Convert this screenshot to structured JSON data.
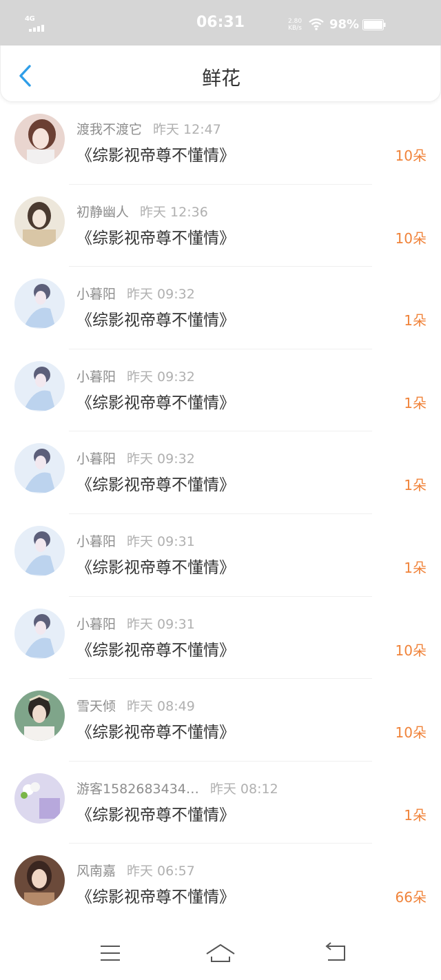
{
  "status_bar": {
    "network": "4G",
    "time": "06:31",
    "speed_value": "2.80",
    "speed_unit": "KB/s",
    "battery": "98%"
  },
  "header": {
    "title": "鲜花",
    "back_icon": "chevron-left-icon"
  },
  "colors": {
    "accent_blue": "#2f9ee8",
    "quantity_orange": "#f0833a"
  },
  "gifts": [
    {
      "user": "渡我不渡它",
      "time": "昨天 12:47",
      "book": "《综影视帝尊不懂情》",
      "quantity": "10朵"
    },
    {
      "user": "初静幽人",
      "time": "昨天 12:36",
      "book": "《综影视帝尊不懂情》",
      "quantity": "10朵"
    },
    {
      "user": "小暮阳",
      "time": "昨天 09:32",
      "book": "《综影视帝尊不懂情》",
      "quantity": "1朵"
    },
    {
      "user": "小暮阳",
      "time": "昨天 09:32",
      "book": "《综影视帝尊不懂情》",
      "quantity": "1朵"
    },
    {
      "user": "小暮阳",
      "time": "昨天 09:32",
      "book": "《综影视帝尊不懂情》",
      "quantity": "1朵"
    },
    {
      "user": "小暮阳",
      "time": "昨天 09:31",
      "book": "《综影视帝尊不懂情》",
      "quantity": "1朵"
    },
    {
      "user": "小暮阳",
      "time": "昨天 09:31",
      "book": "《综影视帝尊不懂情》",
      "quantity": "10朵"
    },
    {
      "user": "雪天倾",
      "time": "昨天 08:49",
      "book": "《综影视帝尊不懂情》",
      "quantity": "10朵"
    },
    {
      "user": "游客1582683434…",
      "time": "昨天 08:12",
      "book": "《综影视帝尊不懂情》",
      "quantity": "1朵"
    },
    {
      "user": "风南嘉",
      "time": "昨天 06:57",
      "book": "《综影视帝尊不懂情》",
      "quantity": "66朵"
    }
  ],
  "bottom_nav": {
    "menu_icon": "menu-icon",
    "home_icon": "home-icon",
    "back_icon": "back-icon"
  }
}
